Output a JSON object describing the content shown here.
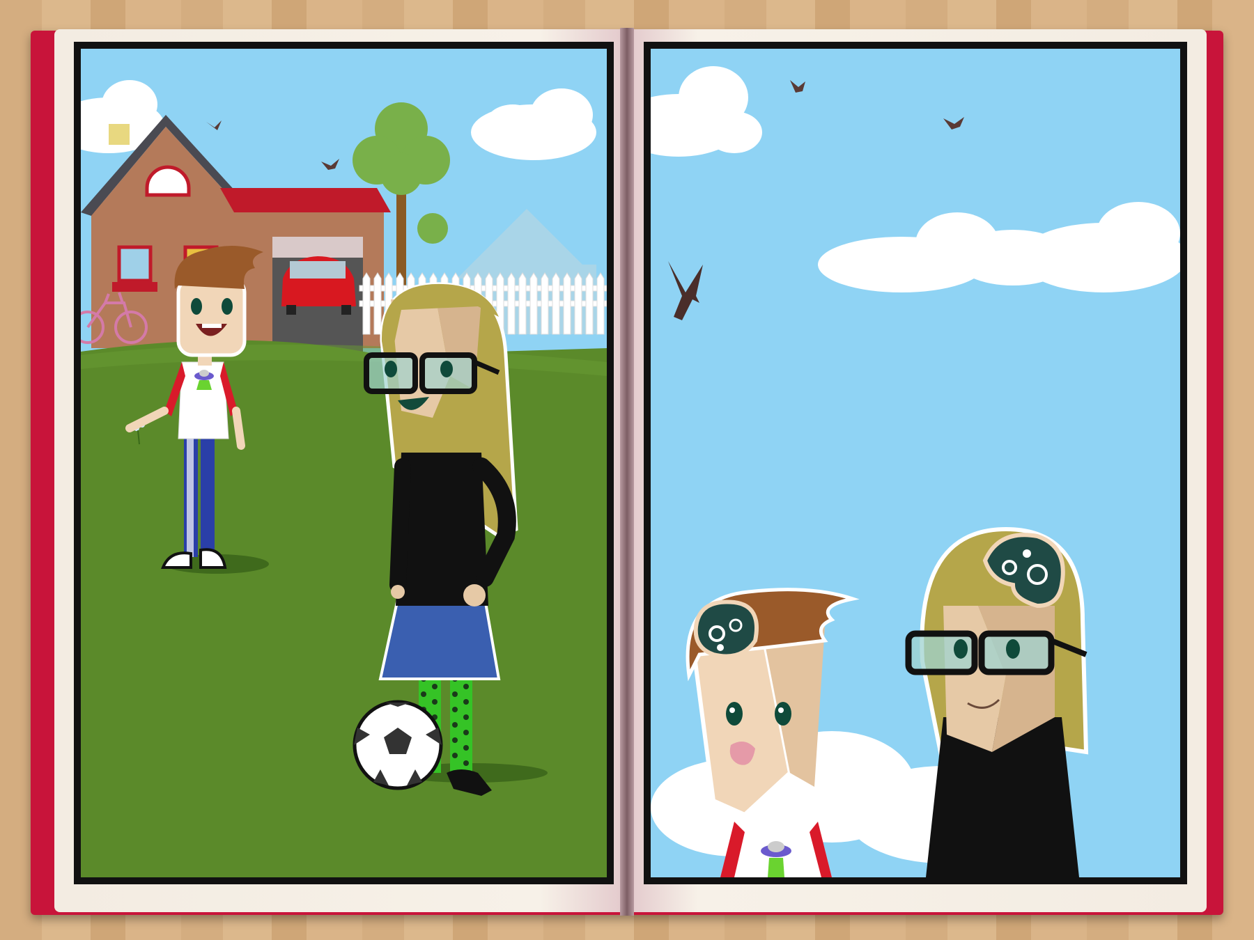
{
  "scene": {
    "left_panel": "left-panel",
    "right_panel": "right-panel"
  },
  "colors": {
    "sky": "#8fd3f4",
    "grass": "#5b8a2a",
    "book_cover": "#c8143a",
    "page": "#f6efe6",
    "hair_boy": "#9a5a2a",
    "hair_girl": "#b5a64a",
    "skirt": "#3a5fb0",
    "tights": "#35c326"
  },
  "icons": [
    "bird-icon",
    "cloud-icon",
    "house-icon",
    "car-icon",
    "bicycle-icon",
    "tree-icon",
    "soccer-ball-icon",
    "ufo-icon",
    "brain-gears-icon"
  ]
}
